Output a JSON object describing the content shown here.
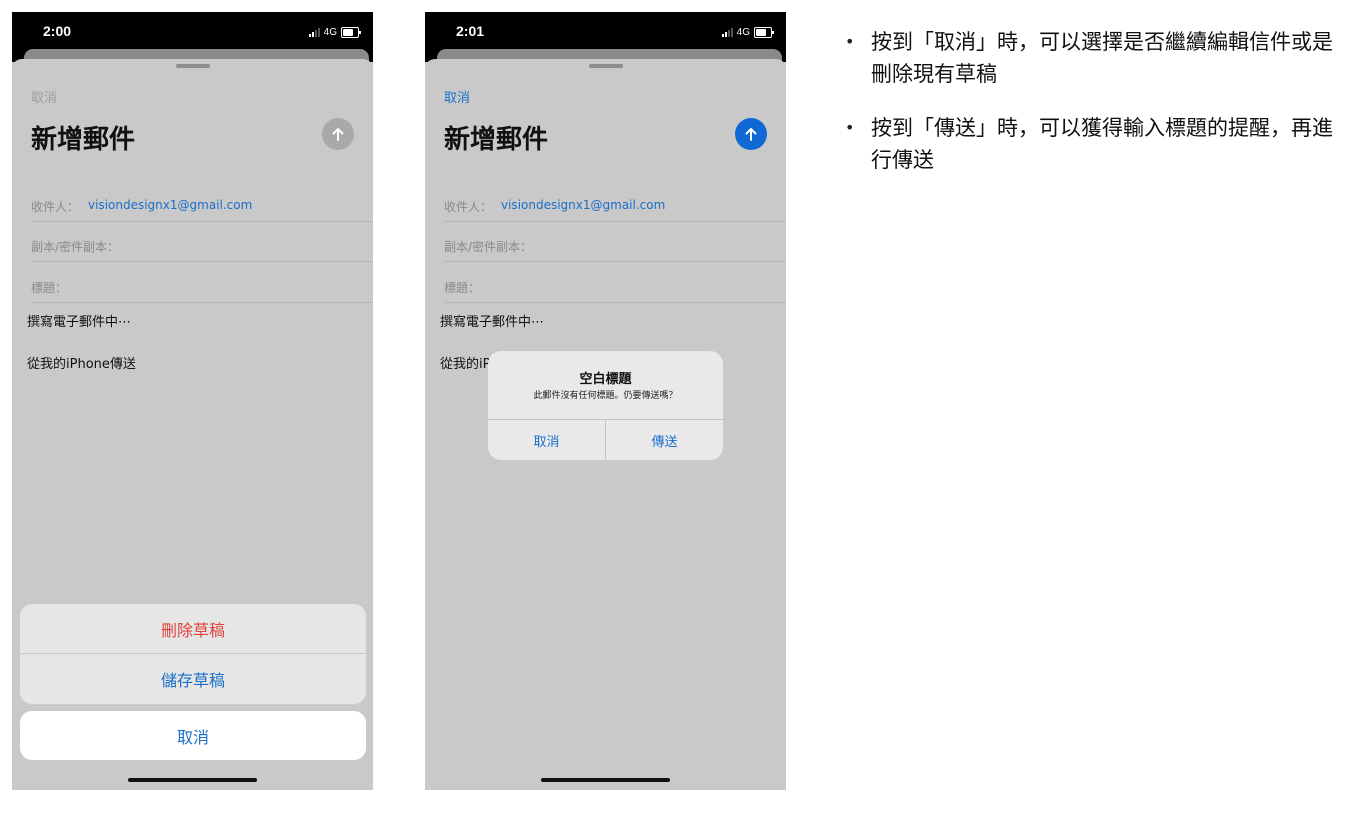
{
  "screens": [
    {
      "status_time": "2:00",
      "network": "4G",
      "cancel_label": "取消",
      "title": "新增郵件",
      "to_label": "收件人：",
      "to_value": "visiondesignx1@gmail.com",
      "cc_label": "副本/密件副本：",
      "subject_label": "標題：",
      "body_placeholder": "撰寫電子郵件中⋯",
      "signature": "從我的iPhone傳送",
      "action_sheet": {
        "delete_draft": "刪除草稿",
        "save_draft": "儲存草稿",
        "cancel": "取消"
      }
    },
    {
      "status_time": "2:01",
      "network": "4G",
      "cancel_label": "取消",
      "title": "新增郵件",
      "to_label": "收件人：",
      "to_value": "visiondesignx1@gmail.com",
      "cc_label": "副本/密件副本：",
      "subject_label": "標題：",
      "body_placeholder": "撰寫電子郵件中⋯",
      "signature": "從我的iPhone傳送",
      "alert": {
        "title": "空白標題",
        "message": "此郵件沒有任何標題。仍要傳送嗎？",
        "cancel": "取消",
        "send": "傳送"
      }
    }
  ],
  "notes": [
    "按到「取消」時，可以選擇是否繼續編輯信件或是刪除現有草稿",
    "按到「傳送」時，可以獲得輸入標題的提醒，再進行傳送"
  ],
  "colors": {
    "accent": "#1a73cf",
    "destructive": "#e0413a",
    "send_active": "#1068d4",
    "send_disabled": "#a9a9a9"
  },
  "icons": [
    "arrow-up-icon",
    "signal-icon",
    "battery-icon",
    "bullet-icon"
  ]
}
